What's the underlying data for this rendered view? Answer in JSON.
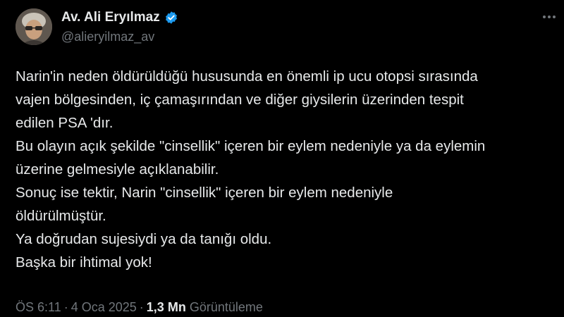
{
  "author": {
    "display_name": "Av. Ali Eryılmaz",
    "handle": "@alieryilmaz_av",
    "verified": true
  },
  "tweet": {
    "lines": [
      "Narin'in neden öldürüldüğü hususunda en önemli ip ucu otopsi sırasında",
      "vajen bölgesinden, iç çamaşırından ve diğer giysilerin üzerinden tespit",
      "edilen PSA 'dır.",
      "Bu olayın açık şekilde \"cinsellik\" içeren bir eylem nedeniyle ya da eylemin",
      "üzerine gelmesiyle açıklanabilir.",
      "Sonuç ise tektir, Narin \"cinsellik\" içeren bir eylem nedeniyle",
      "öldürülmüştür.",
      "Ya doğrudan sujesiydi ya da tanığı oldu.",
      "Başka bir ihtimal yok!"
    ]
  },
  "meta": {
    "time": "ÖS 6:11",
    "separator": "·",
    "date": "4 Oca 2025",
    "views_count": "1,3 Mn",
    "views_label": "Görüntüleme"
  },
  "icons": {
    "verified": "verified-badge-icon",
    "more": "more-options-icon"
  },
  "colors": {
    "background": "#000000",
    "text_primary": "#e7e9ea",
    "text_secondary": "#71767b",
    "verified_blue": "#1d9bf0"
  }
}
